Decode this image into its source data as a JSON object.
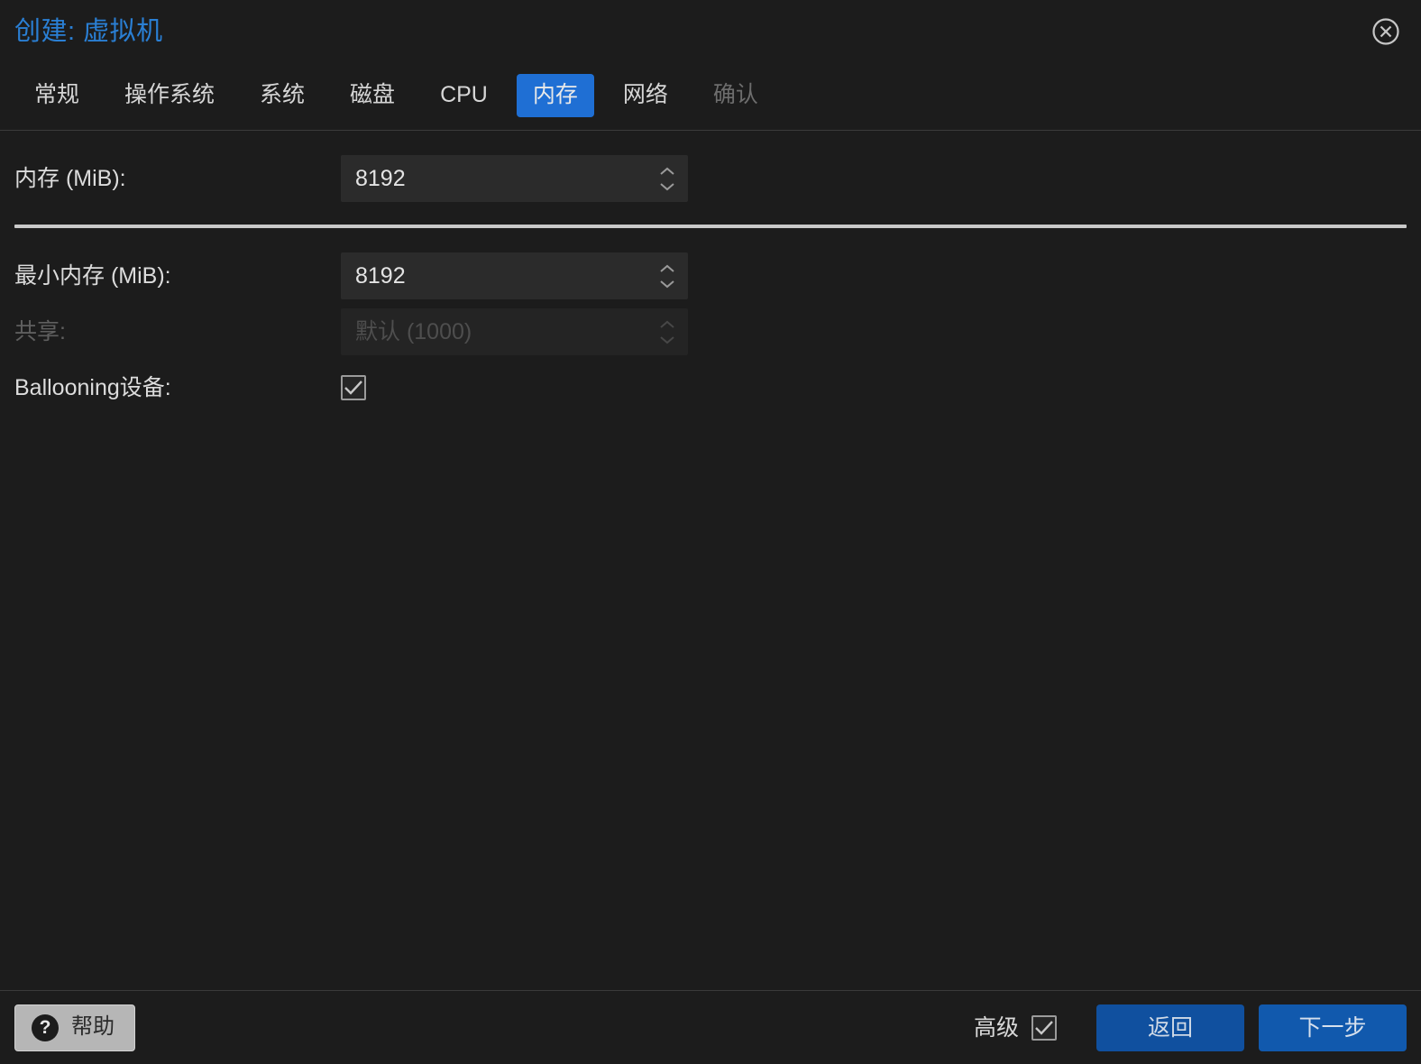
{
  "window": {
    "title": "创建: 虚拟机",
    "close_icon": "close-circle-icon"
  },
  "tabs": [
    {
      "label": "常规",
      "state": "normal"
    },
    {
      "label": "操作系统",
      "state": "normal"
    },
    {
      "label": "系统",
      "state": "normal"
    },
    {
      "label": "磁盘",
      "state": "normal"
    },
    {
      "label": "CPU",
      "state": "normal"
    },
    {
      "label": "内存",
      "state": "active"
    },
    {
      "label": "网络",
      "state": "normal"
    },
    {
      "label": "确认",
      "state": "disabled"
    }
  ],
  "form": {
    "memory": {
      "label": "内存 (MiB):",
      "value": "8192",
      "spinner_icon": "spinner-up-down-icon"
    },
    "min_memory": {
      "label": "最小内存 (MiB):",
      "value": "8192",
      "spinner_icon": "spinner-up-down-icon"
    },
    "shares": {
      "label": "共享:",
      "value": "默认 (1000)",
      "spinner_icon": "spinner-up-down-icon",
      "disabled": true
    },
    "ballooning": {
      "label": "Ballooning设备:",
      "checked": true,
      "check_icon": "checkmark-icon"
    }
  },
  "footer": {
    "help_label": "帮助",
    "help_icon": "question-mark-icon",
    "advanced_label": "高级",
    "advanced_checked": true,
    "advanced_check_icon": "checkmark-icon",
    "back_label": "返回",
    "next_label": "下一步"
  },
  "colors": {
    "accent_blue": "#1f6fd4",
    "title_blue": "#2a7fd4",
    "button_blue": "#10509f",
    "background": "#1c1c1c",
    "field_background": "#2b2b2b"
  }
}
